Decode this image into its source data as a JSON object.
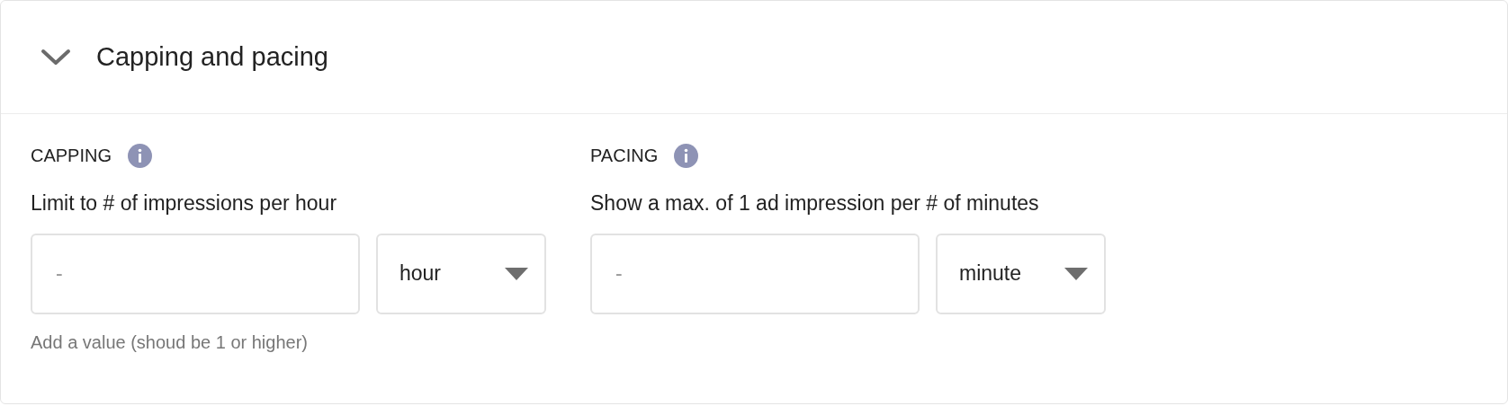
{
  "section": {
    "title": "Capping and pacing",
    "expanded": true
  },
  "groups": [
    {
      "label": "CAPPING",
      "description": "Limit to # of impressions per hour",
      "placeholder": "-",
      "unit": "hour",
      "hint": "Add a value (shoud be 1 or higher)"
    },
    {
      "label": "PACING",
      "description": "Show a max. of 1 ad impression per # of minutes",
      "placeholder": "-",
      "unit": "minute"
    }
  ]
}
